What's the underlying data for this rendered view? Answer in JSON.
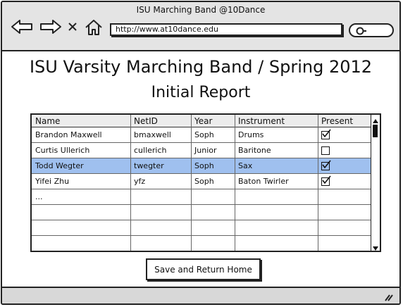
{
  "window": {
    "title": "ISU Marching Band @10Dance"
  },
  "browser": {
    "url": "http://www.at10dance.edu"
  },
  "page": {
    "title": "ISU Varsity Marching Band / Spring 2012",
    "subtitle": "Initial Report"
  },
  "table": {
    "columns": [
      "Name",
      "NetID",
      "Year",
      "Instrument",
      "Present"
    ],
    "rows": [
      {
        "name": "Brandon Maxwell",
        "netid": "bmaxwell",
        "year": "Soph",
        "instrument": "Drums",
        "present": true,
        "selected": false
      },
      {
        "name": "Curtis Ullerich",
        "netid": "cullerich",
        "year": "Junior",
        "instrument": "Baritone",
        "present": false,
        "selected": false
      },
      {
        "name": "Todd Wegter",
        "netid": "twegter",
        "year": "Soph",
        "instrument": "Sax",
        "present": true,
        "selected": true
      },
      {
        "name": "Yifei Zhu",
        "netid": "yfz",
        "year": "Soph",
        "instrument": "Baton Twirler",
        "present": true,
        "selected": false
      },
      {
        "name": "...",
        "netid": "",
        "year": "",
        "instrument": "",
        "present": null,
        "selected": false
      },
      {
        "name": "",
        "netid": "",
        "year": "",
        "instrument": "",
        "present": null,
        "selected": false
      },
      {
        "name": "",
        "netid": "",
        "year": "",
        "instrument": "",
        "present": null,
        "selected": false
      },
      {
        "name": "",
        "netid": "",
        "year": "",
        "instrument": "",
        "present": null,
        "selected": false
      }
    ]
  },
  "actions": {
    "save_label": "Save and Return Home"
  },
  "colors": {
    "selected_row": "#9fc0ef",
    "chrome": "#e4e4e4"
  },
  "icons": [
    "back-arrow-icon",
    "forward-arrow-icon",
    "close-icon",
    "home-icon",
    "search-icon",
    "resize-grip-icon"
  ]
}
